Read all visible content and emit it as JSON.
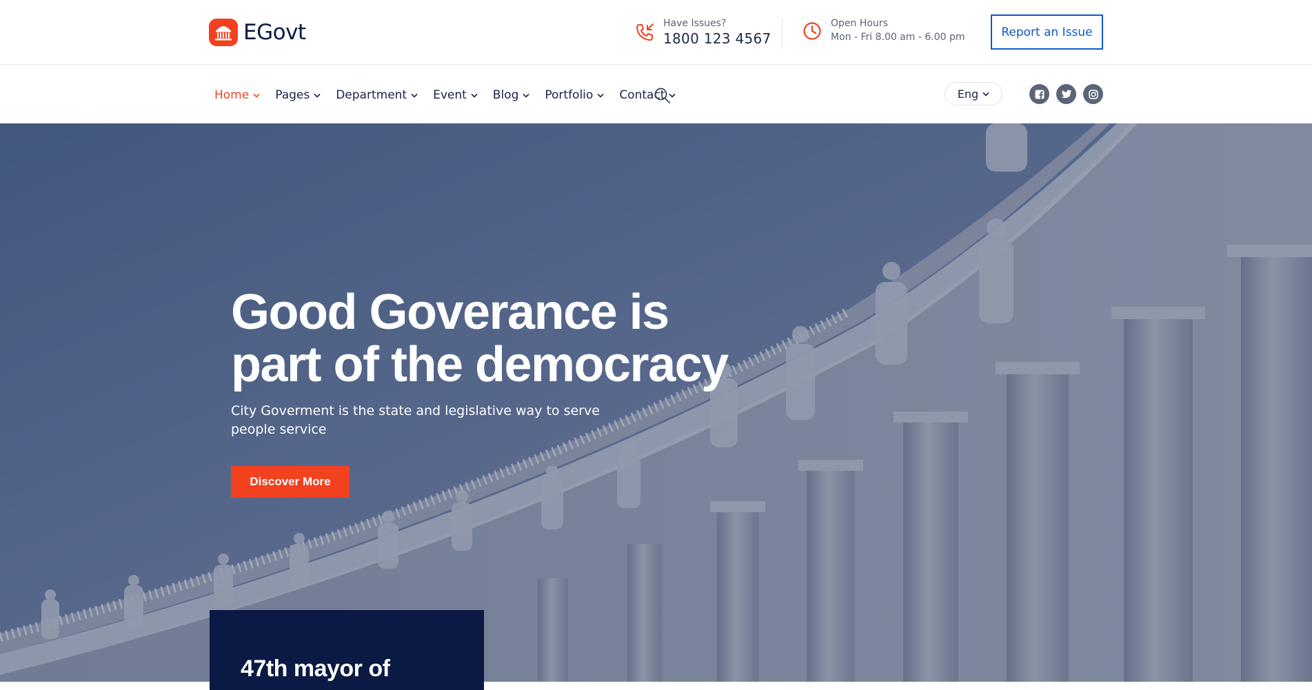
{
  "brand": {
    "name": "EGovt",
    "accent_color": "#f2411f",
    "navy_color": "#0b1a44"
  },
  "contact": {
    "issues_label": "Have Issues?",
    "phone": "1800 123 4567",
    "hours_label": "Open Hours",
    "hours_value": "Mon - Fri 8.00 am - 6.00 pm"
  },
  "header": {
    "report_button": "Report an Issue"
  },
  "nav": {
    "items": [
      {
        "label": "Home",
        "active": true
      },
      {
        "label": "Pages"
      },
      {
        "label": "Department"
      },
      {
        "label": "Event"
      },
      {
        "label": "Blog"
      },
      {
        "label": "Portfolio"
      },
      {
        "label": "Contact"
      }
    ],
    "language": "Eng",
    "socials": [
      "facebook-icon",
      "twitter-icon",
      "instagram-icon"
    ]
  },
  "hero": {
    "title_line1": "Good Goverance is",
    "title_line2": "part of the democracy",
    "subtitle_line1": "City Goverment is the state and legislative way to serve",
    "subtitle_line2": "people service",
    "cta": "Discover More"
  },
  "mayor": {
    "heading": "47th mayor of"
  }
}
